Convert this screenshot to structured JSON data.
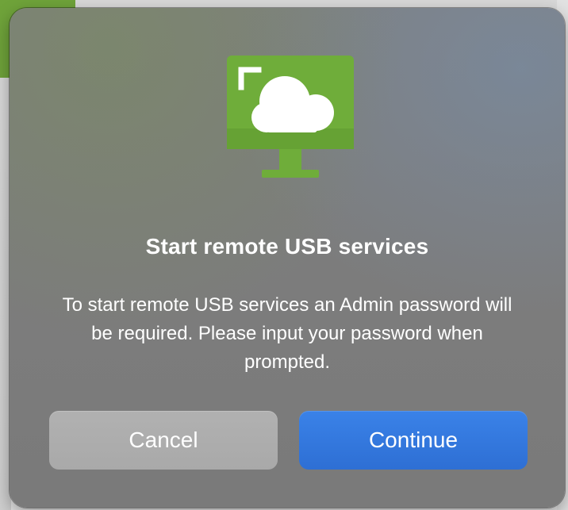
{
  "dialog": {
    "icon": "remote-usb-monitor-cloud-icon",
    "title": "Start remote USB services",
    "message": "To start remote USB services an Admin password will be required.  Please input your password when prompted.",
    "buttons": {
      "cancel_label": "Cancel",
      "continue_label": "Continue"
    }
  },
  "colors": {
    "dialog_bg": "#7d7d7d",
    "icon_green": "#6fad3a",
    "primary_button": "#3277e0",
    "secondary_button": "#adadad",
    "text": "#ffffff"
  }
}
